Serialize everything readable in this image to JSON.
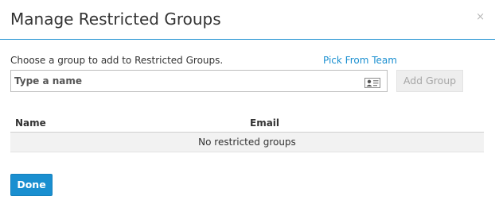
{
  "dialog": {
    "title": "Manage Restricted Groups",
    "close_glyph": "×",
    "close_icon": "close-icon"
  },
  "form": {
    "prompt": "Choose a group to add to Restricted Groups.",
    "pick_from_team": "Pick From Team",
    "name_placeholder": "Type a name",
    "name_value": "",
    "contact_icon": "contact-card-icon",
    "add_group_label": "Add Group"
  },
  "table": {
    "columns": [
      "Name",
      "Email"
    ],
    "empty_message": "No restricted groups"
  },
  "footer": {
    "done_label": "Done"
  },
  "colors": {
    "accent": "#1a8fd0",
    "disabled_button_bg": "#eeeeee",
    "disabled_button_text": "#a6a6a6",
    "empty_row_bg": "#f2f2f2"
  }
}
